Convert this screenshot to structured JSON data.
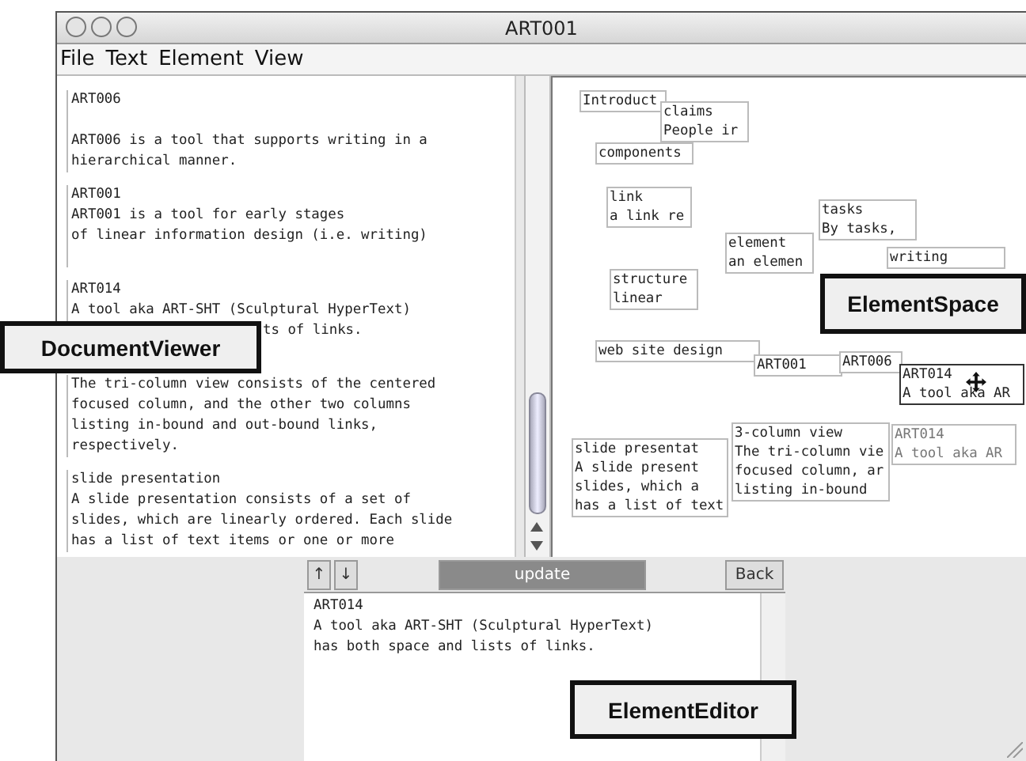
{
  "window": {
    "title": "ART001"
  },
  "menu": [
    "File",
    "Text",
    "Element",
    "View"
  ],
  "document_viewer": {
    "sections": [
      {
        "lines": [
          {
            "text": "ART006"
          },
          {
            "text": "ART006 is a tool that supports writing in a"
          },
          {
            "text": "hierarchical manner."
          }
        ]
      },
      {
        "lines": [
          {
            "text": "ART001"
          },
          {
            "text": "ART001 is a tool for early stages"
          },
          {
            "text": "of linear information design (i.e. writing)"
          }
        ]
      },
      {
        "lines": [
          {
            "text": "ART014"
          },
          {
            "text": "A tool aka ART-SHT (Sculptural HyperText)"
          },
          {
            "text": "ts of links.",
            "partly_covered": true
          }
        ]
      },
      {
        "lines": [
          {
            "text": "The tri-column view consists of the centered"
          },
          {
            "text": "focused column, and the other two columns"
          },
          {
            "text": "listing in-bound and out-bound links,"
          },
          {
            "text": "respectively."
          }
        ]
      },
      {
        "lines": [
          {
            "text": "slide presentation"
          },
          {
            "text": "A slide presentation consists of a set of"
          },
          {
            "text": "slides, which are linearly ordered. Each slide"
          },
          {
            "text": "has a list of text items or one or more"
          }
        ]
      }
    ]
  },
  "element_space": {
    "nodes": [
      {
        "lines": [
          "Introduct"
        ],
        "selected": false
      },
      {
        "lines": [
          "claims",
          "People ir"
        ],
        "selected": false
      },
      {
        "lines": [
          "components"
        ],
        "selected": false
      },
      {
        "lines": [
          "link",
          "a link re"
        ],
        "selected": false
      },
      {
        "lines": [
          "structure",
          "linear"
        ],
        "selected": false
      },
      {
        "lines": [
          "element",
          "an elemen"
        ],
        "selected": false
      },
      {
        "lines": [
          "tasks",
          "By tasks,"
        ],
        "selected": false
      },
      {
        "lines": [
          "writing"
        ],
        "selected": false
      },
      {
        "lines": [
          "web site design"
        ],
        "selected": false
      },
      {
        "lines": [
          "ART001"
        ],
        "selected": false
      },
      {
        "lines": [
          "ART006"
        ],
        "selected": false
      },
      {
        "lines": [
          "ART014",
          "A tool aka AR"
        ],
        "selected": true
      },
      {
        "lines": [
          "slide presentat",
          "A slide present",
          "slides, which a",
          "has a list of text"
        ],
        "selected": false
      },
      {
        "lines": [
          "3-column view",
          "The tri-column vie",
          "focused column, ar",
          "listing in-bound"
        ],
        "selected": false
      },
      {
        "lines": [
          "ART014",
          "A tool aka AR"
        ],
        "selected": false,
        "dimmed": true
      }
    ]
  },
  "element_editor": {
    "up": "↑",
    "down": "↓",
    "update": {
      "label": "update",
      "disabled": true
    },
    "back": "Back",
    "lines": [
      "ART014",
      "A tool aka ART-SHT (Sculptural HyperText)",
      "has both space and lists of links."
    ]
  },
  "callouts": [
    "DocumentViewer",
    "ElementSpace",
    "ElementEditor"
  ]
}
